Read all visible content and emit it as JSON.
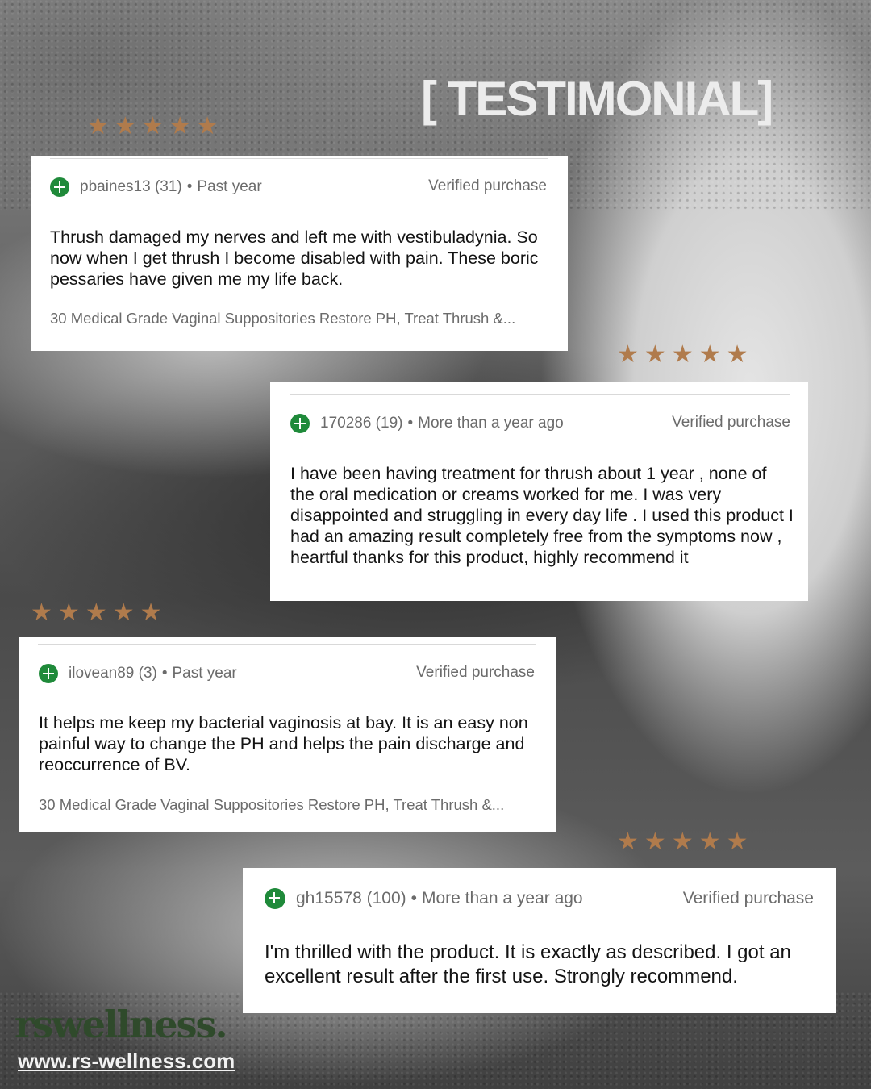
{
  "headline": "[ TESTIMONIAL]",
  "colors": {
    "star": "#b07b4c",
    "verified_icon": "#1f8a3a",
    "brand": "#2f4a2b",
    "card_bg": "#ffffff"
  },
  "reviews": [
    {
      "rating": 5,
      "reviewer": "pbaines13 (31)",
      "when": "Past year",
      "verified": "Verified purchase",
      "text": "Thrush damaged my nerves and left me with vestibuladynia. So now when I get thrush I become disabled with pain. These boric pessaries have given me my life back.",
      "product": "30 Medical Grade Vaginal Suppositories Restore PH, Treat Thrush &..."
    },
    {
      "rating": 5,
      "reviewer": "170286 (19)",
      "when": "More than a year ago",
      "verified": "Verified purchase",
      "text": "I have been having treatment for thrush about 1 year , none of the oral medication or creams worked for me. I was very disappointed and struggling in every day life . I used this product I had an amazing result completely free from the symptoms now , heartful thanks for this product, highly recommend it"
    },
    {
      "rating": 5,
      "reviewer": "ilovean89 (3)",
      "when": "Past year",
      "verified": "Verified purchase",
      "text": "It helps me keep my bacterial vaginosis at bay. It is an easy non painful way to change the PH and helps the pain discharge and reoccurrence of BV.",
      "product": "30 Medical Grade Vaginal Suppositories Restore PH, Treat Thrush &..."
    },
    {
      "rating": 5,
      "reviewer": "gh15578 (100)",
      "when": "More than a year ago",
      "verified": "Verified purchase",
      "text": "I'm thrilled with the product. It is exactly as described. I got an excellent result after the first use. Strongly recommend."
    }
  ],
  "brand": {
    "logo_text": "rswellness.",
    "url": "www.rs-wellness.com"
  }
}
